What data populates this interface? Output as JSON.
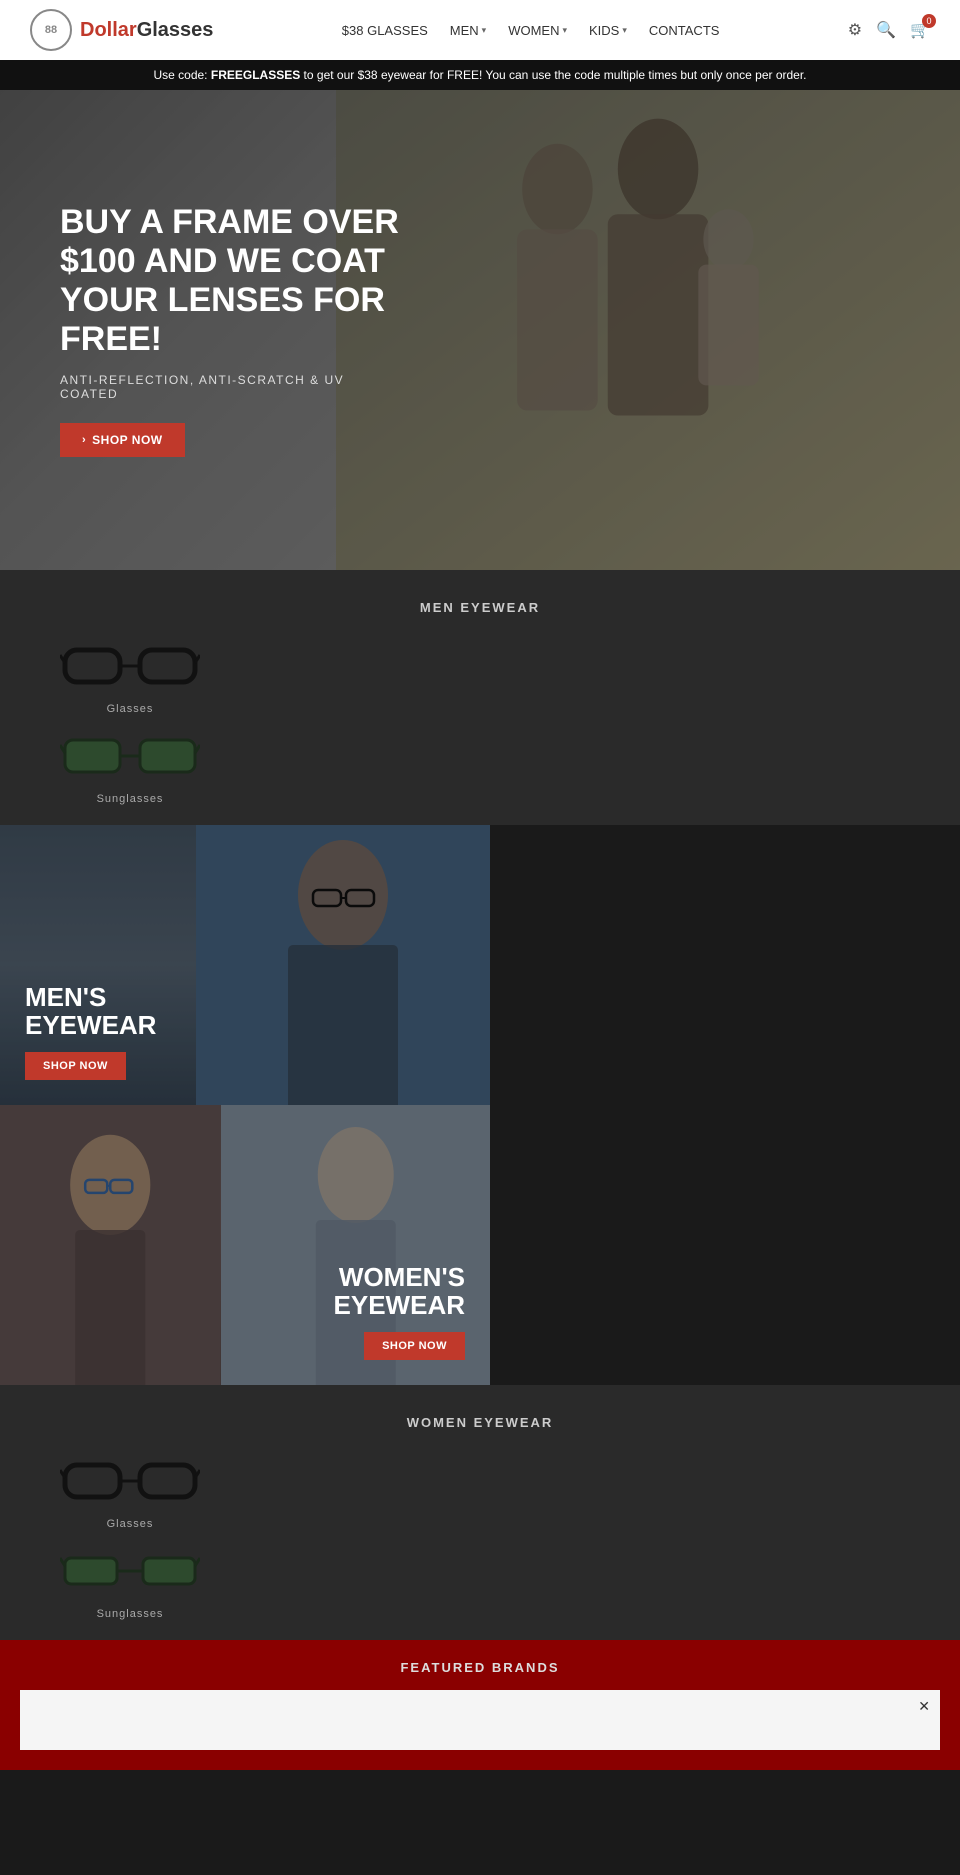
{
  "header": {
    "logo_icon": "88",
    "logo_brand": "Dollar",
    "logo_suffix": "Glasses",
    "nav": [
      {
        "label": "$38 GLASSES",
        "has_arrow": false,
        "id": "nav-38glasses"
      },
      {
        "label": "MEN",
        "has_arrow": true,
        "id": "nav-men"
      },
      {
        "label": "WOMEN",
        "has_arrow": true,
        "id": "nav-women"
      },
      {
        "label": "KIDS",
        "has_arrow": true,
        "id": "nav-kids"
      },
      {
        "label": "CONTACTS",
        "has_arrow": false,
        "id": "nav-contacts"
      }
    ],
    "cart_count": "0"
  },
  "promo": {
    "text_before": "Use code: ",
    "code": "FREEGLASSES",
    "text_after": " to get our $38 eyewear for FREE! You can use the code multiple times but only once per order."
  },
  "hero": {
    "title": "BUY A FRAME OVER $100 AND WE COAT YOUR LENSES FOR FREE!",
    "subtitle": "ANTI-REFLECTION, ANTI-SCRATCH & UV COATED",
    "cta_label": "SHOP NOW"
  },
  "men_eyewear": {
    "section_title": "MEN EYEWEAR",
    "items": [
      {
        "label": "Glasses",
        "type": "clear"
      },
      {
        "label": "Sunglasses",
        "type": "dark"
      }
    ]
  },
  "banner_men": {
    "title_line1": "MEN'S",
    "title_line2": "EYEWEAR",
    "cta_label": "SHOP NOW"
  },
  "banner_women": {
    "title_line1": "WOMEN'S",
    "title_line2": "EYEWEAR",
    "cta_label": "SHOP NOW"
  },
  "women_eyewear": {
    "section_title": "WOMEN EYEWEAR",
    "items": [
      {
        "label": "Glasses",
        "type": "clear"
      },
      {
        "label": "Sunglasses",
        "type": "dark"
      }
    ]
  },
  "featured_brands": {
    "section_title": "FEATURED BRANDS"
  },
  "colors": {
    "accent": "#c0392b",
    "dark_bg": "#1a1a1a",
    "section_bg": "#2a2a2a",
    "header_bg": "#ffffff"
  }
}
